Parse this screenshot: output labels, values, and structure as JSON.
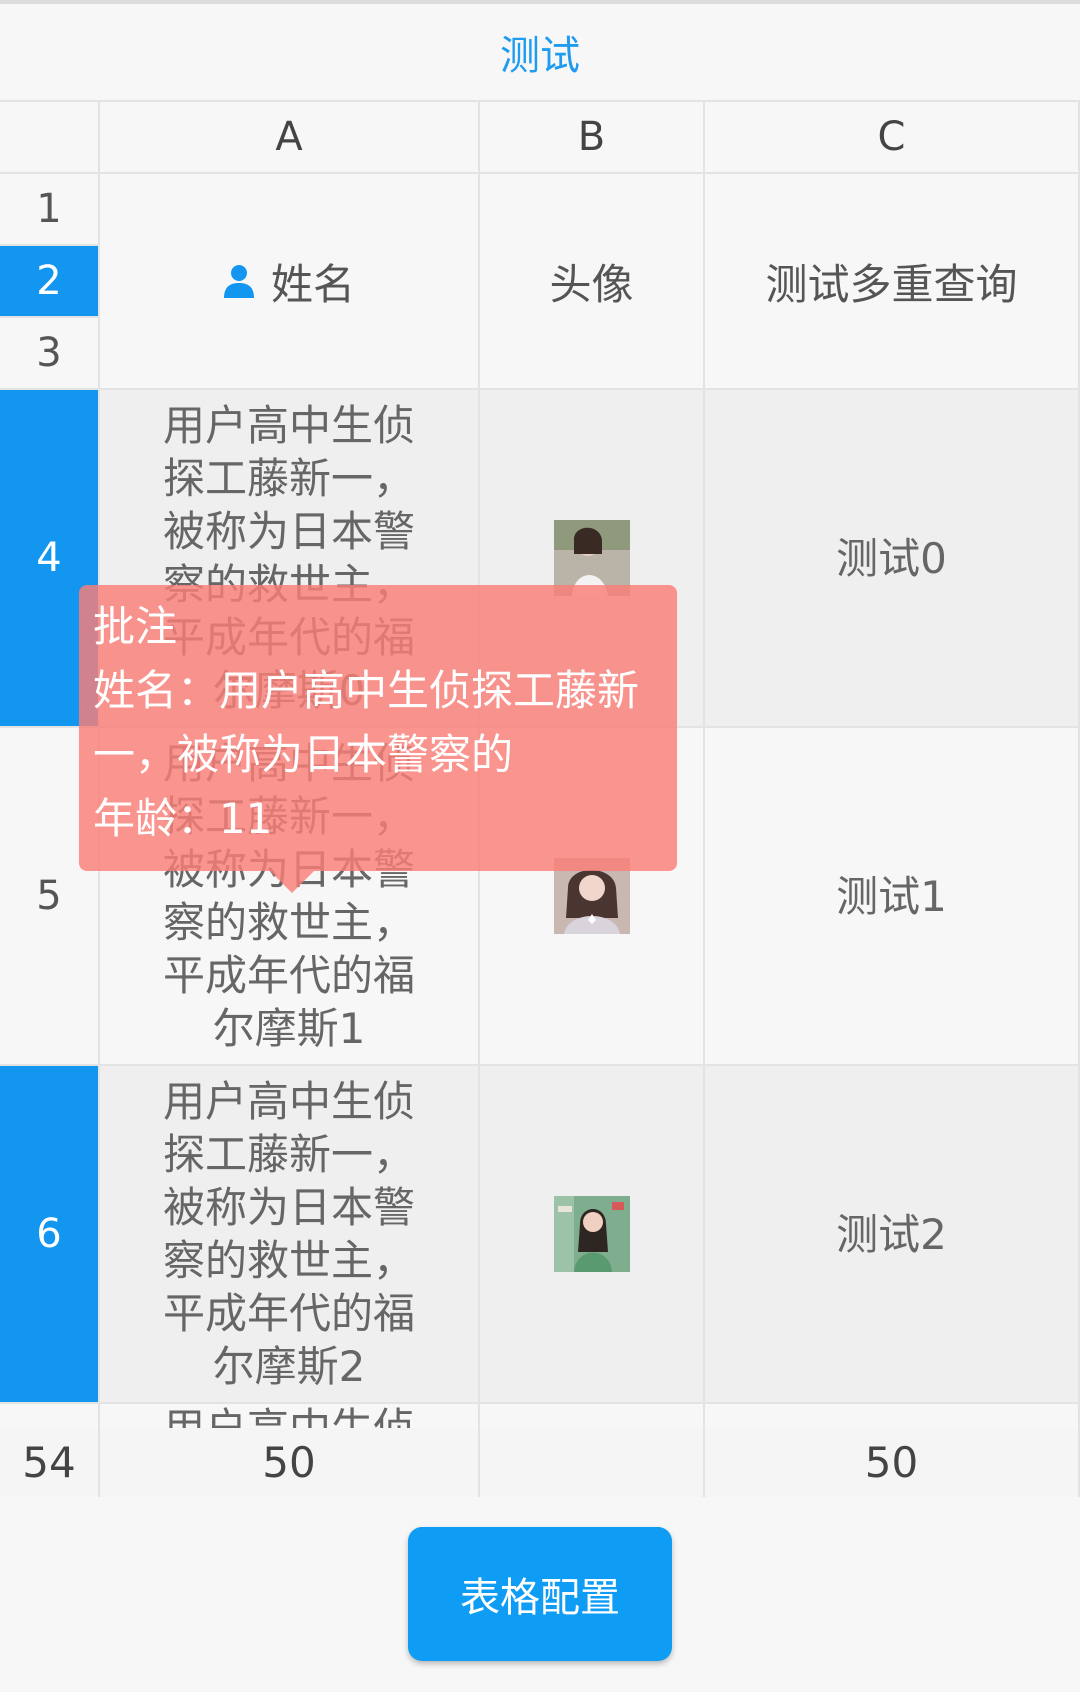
{
  "header": {
    "title": "测试"
  },
  "columns": [
    {
      "letter": "A"
    },
    {
      "letter": "B"
    },
    {
      "letter": "C"
    }
  ],
  "row_numbers": {
    "r1": "1",
    "r2": "2",
    "r3": "3",
    "r4": "4",
    "r5": "5",
    "r6": "6",
    "footer": "54"
  },
  "table_header": {
    "name": "姓名",
    "avatar": "头像",
    "multi_query": "测试多重查询"
  },
  "rows": [
    {
      "desc": "用户高中生侦探工藤新一，被称为日本警察的救世主，平成年代的福尔摩斯0",
      "query": "测试0"
    },
    {
      "desc": "用户高中生侦探工藤新一，被称为日本警察的救世主，平成年代的福尔摩斯1",
      "query": "测试1"
    },
    {
      "desc": "用户高中生侦探工藤新一，被称为日本警察的救世主，平成年代的福尔摩斯2",
      "query": "测试2"
    }
  ],
  "partial_row_text": "用户高中生侦",
  "footer_row": {
    "a": "50",
    "b": "",
    "c": "50"
  },
  "comment": {
    "title": "批注",
    "line1": "姓名：用户高中生侦探工藤新",
    "line2": "一，被称为日本警察的",
    "line3": "年龄：11"
  },
  "button": {
    "label": "表格配置"
  },
  "colors": {
    "accent": "#1296f0",
    "comment_bg": "#fa7e76",
    "button": "#0f9cf5"
  }
}
